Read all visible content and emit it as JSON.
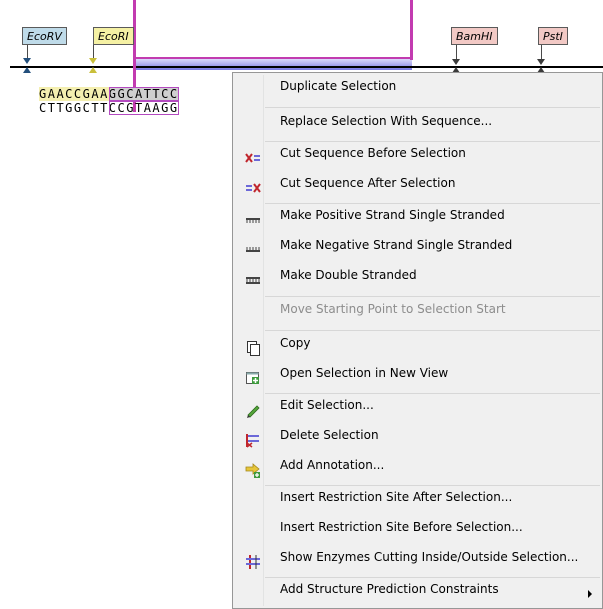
{
  "map": {
    "enzymes_left": [
      "EcoRV",
      "EcoRI"
    ],
    "enzymes_right": [
      "BamHI",
      "PstI"
    ]
  },
  "sequence": {
    "top_pre": "GAACCGAA",
    "top_sel": "GGCATTCC",
    "bottom_pre": "CTTGGCTT",
    "bottom_sel": "CCGTAAGG"
  },
  "menu": {
    "items": [
      {
        "label": "Duplicate Selection",
        "icon": "none",
        "enabled": true
      },
      {
        "label": "Replace Selection With Sequence...",
        "icon": "none",
        "enabled": true
      },
      {
        "label": "Cut Sequence Before Selection",
        "icon": "cut-before-icon",
        "enabled": true
      },
      {
        "label": "Cut Sequence After Selection",
        "icon": "cut-after-icon",
        "enabled": true
      },
      {
        "label": "Make Positive Strand Single Stranded",
        "icon": "positive-strand-icon",
        "enabled": true
      },
      {
        "label": "Make Negative Strand Single Stranded",
        "icon": "negative-strand-icon",
        "enabled": true
      },
      {
        "label": "Make Double Stranded",
        "icon": "double-strand-icon",
        "enabled": true
      },
      {
        "label": "Move Starting Point to Selection Start",
        "icon": "none",
        "enabled": false
      },
      {
        "label": "Copy",
        "icon": "copy-icon",
        "enabled": true
      },
      {
        "label": "Open Selection in New View",
        "icon": "new-view-icon",
        "enabled": true
      },
      {
        "label": "Edit Selection...",
        "icon": "pencil-icon",
        "enabled": true
      },
      {
        "label": "Delete Selection",
        "icon": "delete-selection-icon",
        "enabled": true
      },
      {
        "label": "Add Annotation...",
        "icon": "add-annotation-icon",
        "enabled": true
      },
      {
        "label": "Insert Restriction Site After Selection...",
        "icon": "none",
        "enabled": true
      },
      {
        "label": "Insert Restriction Site Before Selection...",
        "icon": "none",
        "enabled": true
      },
      {
        "label": "Show Enzymes Cutting Inside/Outside Selection...",
        "icon": "enzymes-icon",
        "enabled": true
      },
      {
        "label": "Add Structure Prediction Constraints",
        "icon": "none",
        "enabled": true,
        "submenu": true
      }
    ]
  },
  "colors": {
    "selection": "#c23bb0",
    "menu_bg": "#f0f0f0",
    "disabled_text": "#8d8d8d"
  }
}
